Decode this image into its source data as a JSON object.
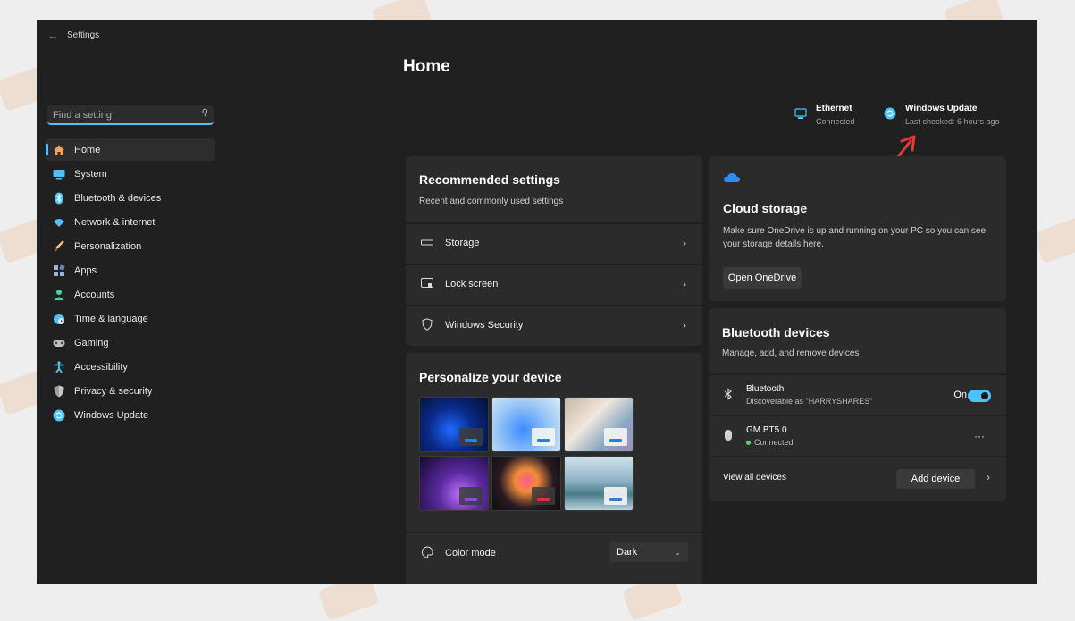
{
  "window": {
    "title": "Settings"
  },
  "search": {
    "placeholder": "Find a setting"
  },
  "sidebar": {
    "items": [
      {
        "label": "Home",
        "icon": "home-icon",
        "color": "#f2a65a"
      },
      {
        "label": "System",
        "icon": "monitor-icon",
        "color": "#4cc2ff"
      },
      {
        "label": "Bluetooth & devices",
        "icon": "bluetooth-icon",
        "color": "#4cc2ff"
      },
      {
        "label": "Network & internet",
        "icon": "wifi-icon",
        "color": "#4cc2ff"
      },
      {
        "label": "Personalization",
        "icon": "brush-icon",
        "color": "#e8a060"
      },
      {
        "label": "Apps",
        "icon": "apps-icon",
        "color": "#9db4d8"
      },
      {
        "label": "Accounts",
        "icon": "person-icon",
        "color": "#3dd6a0"
      },
      {
        "label": "Time & language",
        "icon": "globe-clock-icon",
        "color": "#4cc2ff"
      },
      {
        "label": "Gaming",
        "icon": "gamepad-icon",
        "color": "#c0c0c0"
      },
      {
        "label": "Accessibility",
        "icon": "accessibility-icon",
        "color": "#4cc2ff"
      },
      {
        "label": "Privacy & security",
        "icon": "shield-icon",
        "color": "#a0a0a0"
      },
      {
        "label": "Windows Update",
        "icon": "update-icon",
        "color": "#4cc2ff"
      }
    ]
  },
  "main": {
    "title": "Home",
    "status": {
      "ethernet": {
        "title": "Ethernet",
        "subtitle": "Connected"
      },
      "update": {
        "title": "Windows Update",
        "subtitle": "Last checked: 6 hours ago"
      }
    },
    "recommended": {
      "title": "Recommended settings",
      "subtitle": "Recent and commonly used settings",
      "rows": [
        {
          "label": "Storage",
          "icon": "storage-icon"
        },
        {
          "label": "Lock screen",
          "icon": "lock-screen-icon"
        },
        {
          "label": "Windows Security",
          "icon": "shield-outline-icon"
        }
      ]
    },
    "personalize": {
      "title": "Personalize your device",
      "color_mode_label": "Color mode",
      "color_mode_value": "Dark"
    },
    "cloud": {
      "title": "Cloud storage",
      "description": "Make sure OneDrive is up and running on your PC so you can see your storage details here.",
      "button": "Open OneDrive"
    },
    "bluetooth": {
      "title": "Bluetooth devices",
      "subtitle": "Manage, add, and remove devices",
      "toggle_row": {
        "label": "Bluetooth",
        "sub": "Discoverable as \"HARRYSHARES\"",
        "state": "On"
      },
      "device": {
        "label": "GM BT5.0",
        "sub": "Connected"
      },
      "view_all": "View all devices",
      "add_device": "Add device"
    }
  },
  "colors": {
    "accent": "#4cc2ff",
    "annotation_arrow": "#e53935"
  }
}
